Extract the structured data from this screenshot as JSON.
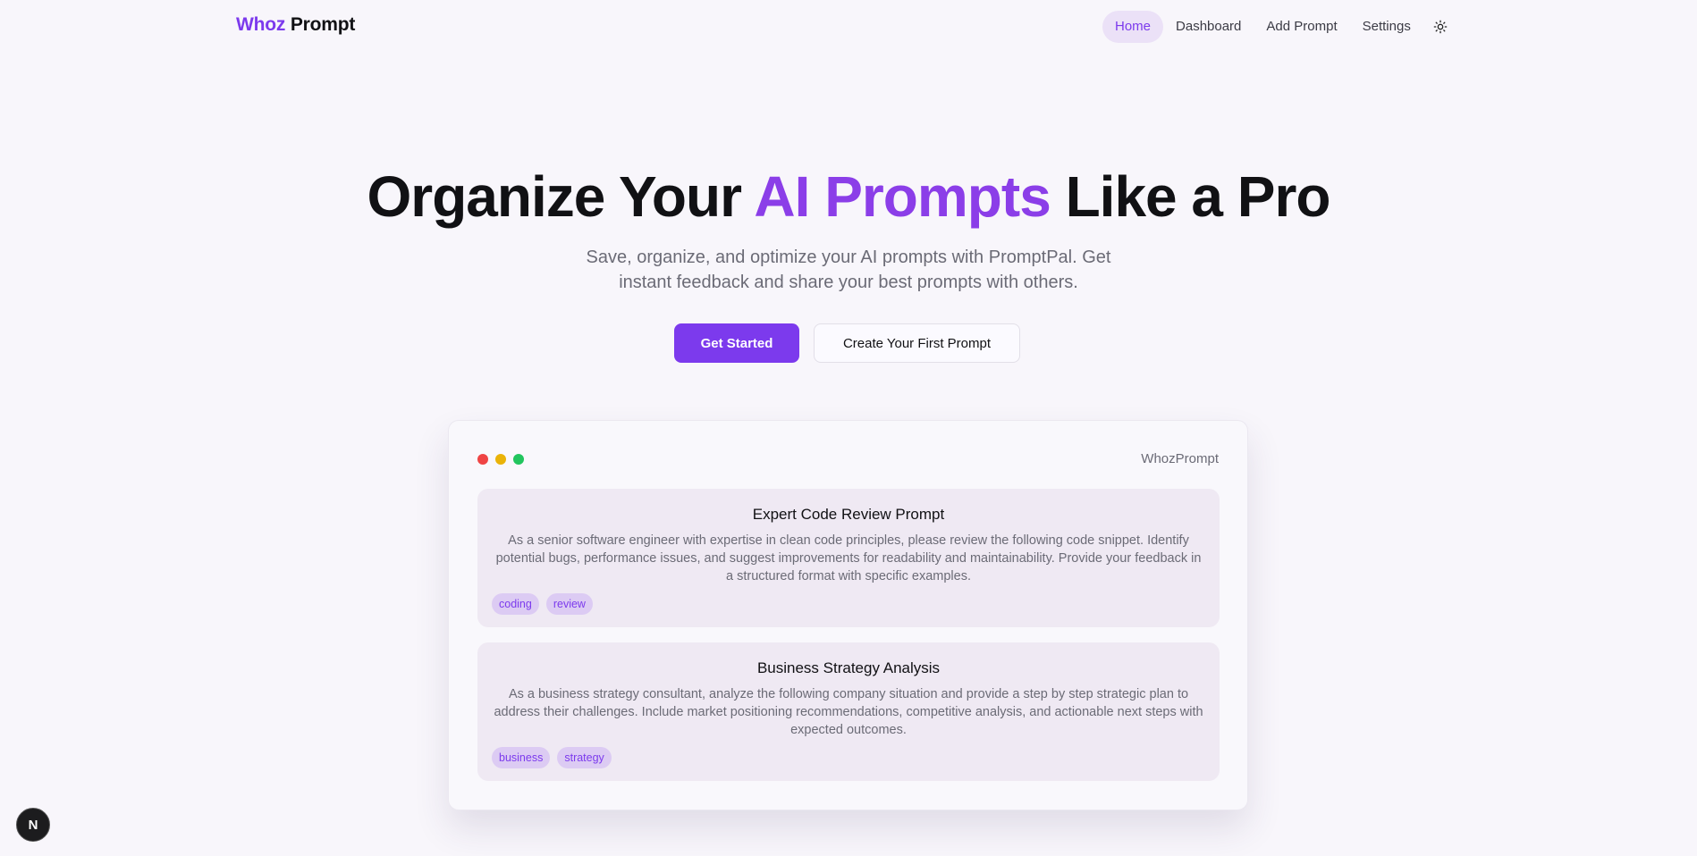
{
  "navbar": {
    "logo_accent": "Whoz",
    "logo_rest": "Prompt",
    "links": [
      {
        "label": "Home"
      },
      {
        "label": "Dashboard"
      },
      {
        "label": "Add Prompt"
      },
      {
        "label": "Settings"
      }
    ],
    "theme_toggle_icon": "sun-icon"
  },
  "hero": {
    "title_start": "Organize Your ",
    "title_accent": "AI Prompts",
    "title_end": " Like a Pro",
    "subtitle": "Save, organize, and optimize your AI prompts with PromptPal. Get instant feedback and share your best prompts with others.",
    "primary_button": "Get Started",
    "secondary_button": "Create Your First Prompt"
  },
  "preview": {
    "window_title": "WhozPrompt",
    "cards": [
      {
        "title": "Expert Code Review Prompt",
        "body": "As a senior software engineer with expertise in clean code principles, please review the following code snippet. Identify potential bugs, performance issues, and suggest improvements for readability and maintainability. Provide your feedback in a structured format with specific examples.",
        "tags": [
          "coding",
          "review"
        ]
      },
      {
        "title": "Business Strategy Analysis",
        "body": "As a business strategy consultant, analyze the following company situation and provide a step by step strategic plan to address their challenges. Include market positioning recommendations, competitive analysis, and actionable next steps with expected outcomes.",
        "tags": [
          "business",
          "strategy"
        ]
      }
    ]
  },
  "badge": {
    "icon": "n-logo-icon",
    "letter": "N"
  },
  "colors": {
    "accent": "#7c3aed",
    "background": "#f8f6fb",
    "card_background": "#efe9f3",
    "dot_red": "#ef4444",
    "dot_yellow": "#eab308",
    "dot_green": "#22c55e"
  }
}
